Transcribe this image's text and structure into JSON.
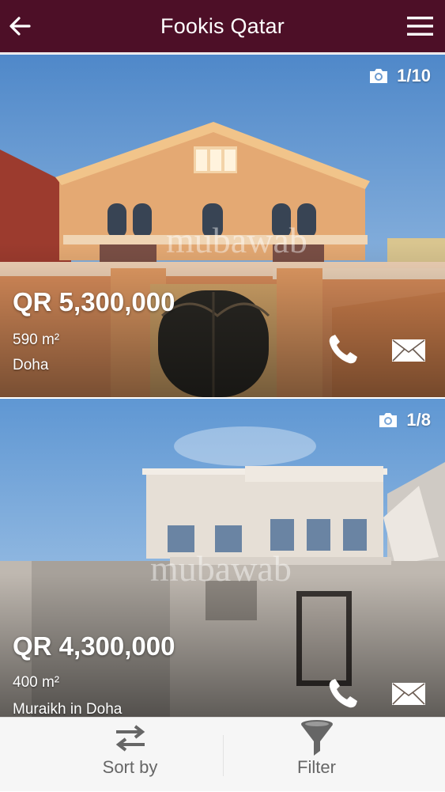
{
  "header": {
    "title": "Fookis Qatar",
    "back_icon": "arrow-left-icon",
    "menu_icon": "hamburger-menu-icon",
    "background": "#4d0f27"
  },
  "listings": [
    {
      "photo_count": "1/10",
      "price": "QR 5,300,000",
      "area": "590 m²",
      "location": "Doha",
      "watermark": "mubawab"
    },
    {
      "photo_count": "1/8",
      "price": "QR 4,300,000",
      "area": "400 m²",
      "location": "Muraikh in Doha",
      "watermark": "mubawab"
    }
  ],
  "bottom_bar": {
    "sort_label": "Sort by",
    "sort_icon": "swap-arrows-icon",
    "filter_label": "Filter",
    "filter_icon": "funnel-icon"
  }
}
